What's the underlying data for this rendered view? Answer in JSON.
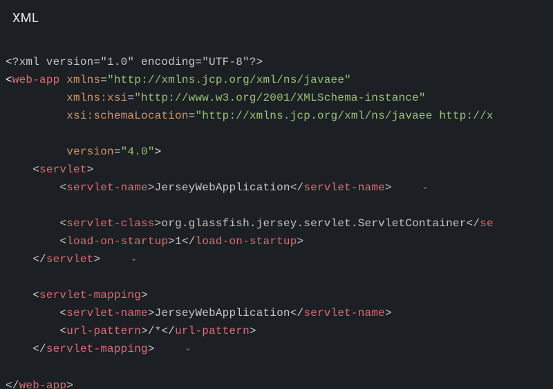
{
  "header": "XML",
  "code": {
    "l1": "<?xml version=\"1.0\" encoding=\"UTF-8\"?>",
    "l2_open": "<",
    "l2_tag": "web-app",
    "l2_sp": " ",
    "l2_attr": "xmlns",
    "l2_eq": "=",
    "l2_val": "\"http://xmlns.jcp.org/xml/ns/javaee\"",
    "l3_pad": "         ",
    "l3_attr": "xmlns:xsi",
    "l3_eq": "=",
    "l3_val": "\"http://www.w3.org/2001/XMLSchema-instance\"",
    "l4_pad": "         ",
    "l4_attr": "xsi:schemaLocation",
    "l4_eq": "=",
    "l4_val": "\"http://xmlns.jcp.org/xml/ns/javaee http://x",
    "l5_pad": "         ",
    "l5_attr": "version",
    "l5_eq": "=",
    "l5_val": "\"4.0\"",
    "l5_close": ">",
    "l6_pad": "    ",
    "l6_open": "<",
    "l6_tag": "servlet",
    "l6_close": ">",
    "l7_pad": "        ",
    "l7_open": "<",
    "l7_tag": "servlet-name",
    "l7_close": ">",
    "l7_text": "JerseyWebApplication",
    "l7_copen": "</",
    "l7_ctag": "servlet-name",
    "l7_cclose": ">",
    "l7_tail": "    ",
    "l8_pad": "        ",
    "l8_open": "<",
    "l8_tag": "servlet-class",
    "l8_close": ">",
    "l8_text": "org.glassfish.jersey.servlet.ServletContainer",
    "l8_copen": "</",
    "l8_ctag": "se",
    "l9_pad": "        ",
    "l9_open": "<",
    "l9_tag": "load-on-startup",
    "l9_close": ">",
    "l9_text": "1",
    "l9_copen": "</",
    "l9_ctag": "load-on-startup",
    "l9_cclose": ">",
    "l10_pad": "    ",
    "l10_copen": "</",
    "l10_ctag": "servlet",
    "l10_cclose": ">",
    "l10_tail": "    ",
    "l11_pad": "    ",
    "l11_open": "<",
    "l11_tag": "servlet-mapping",
    "l11_close": ">",
    "l12_pad": "        ",
    "l12_open": "<",
    "l12_tag": "servlet-name",
    "l12_close": ">",
    "l12_text": "JerseyWebApplication",
    "l12_copen": "</",
    "l12_ctag": "servlet-name",
    "l12_cclose": ">",
    "l13_pad": "        ",
    "l13_open": "<",
    "l13_tag": "url-pattern",
    "l13_close": ">",
    "l13_text": "/*",
    "l13_copen": "</",
    "l13_ctag": "url-pattern",
    "l13_cclose": ">",
    "l14_pad": "    ",
    "l14_copen": "</",
    "l14_ctag": "servlet-mapping",
    "l14_cclose": ">",
    "l14_tail": "    ",
    "l15_copen": "</",
    "l15_ctag": "web-app",
    "l15_cclose": ">",
    "chev": "⌄"
  }
}
